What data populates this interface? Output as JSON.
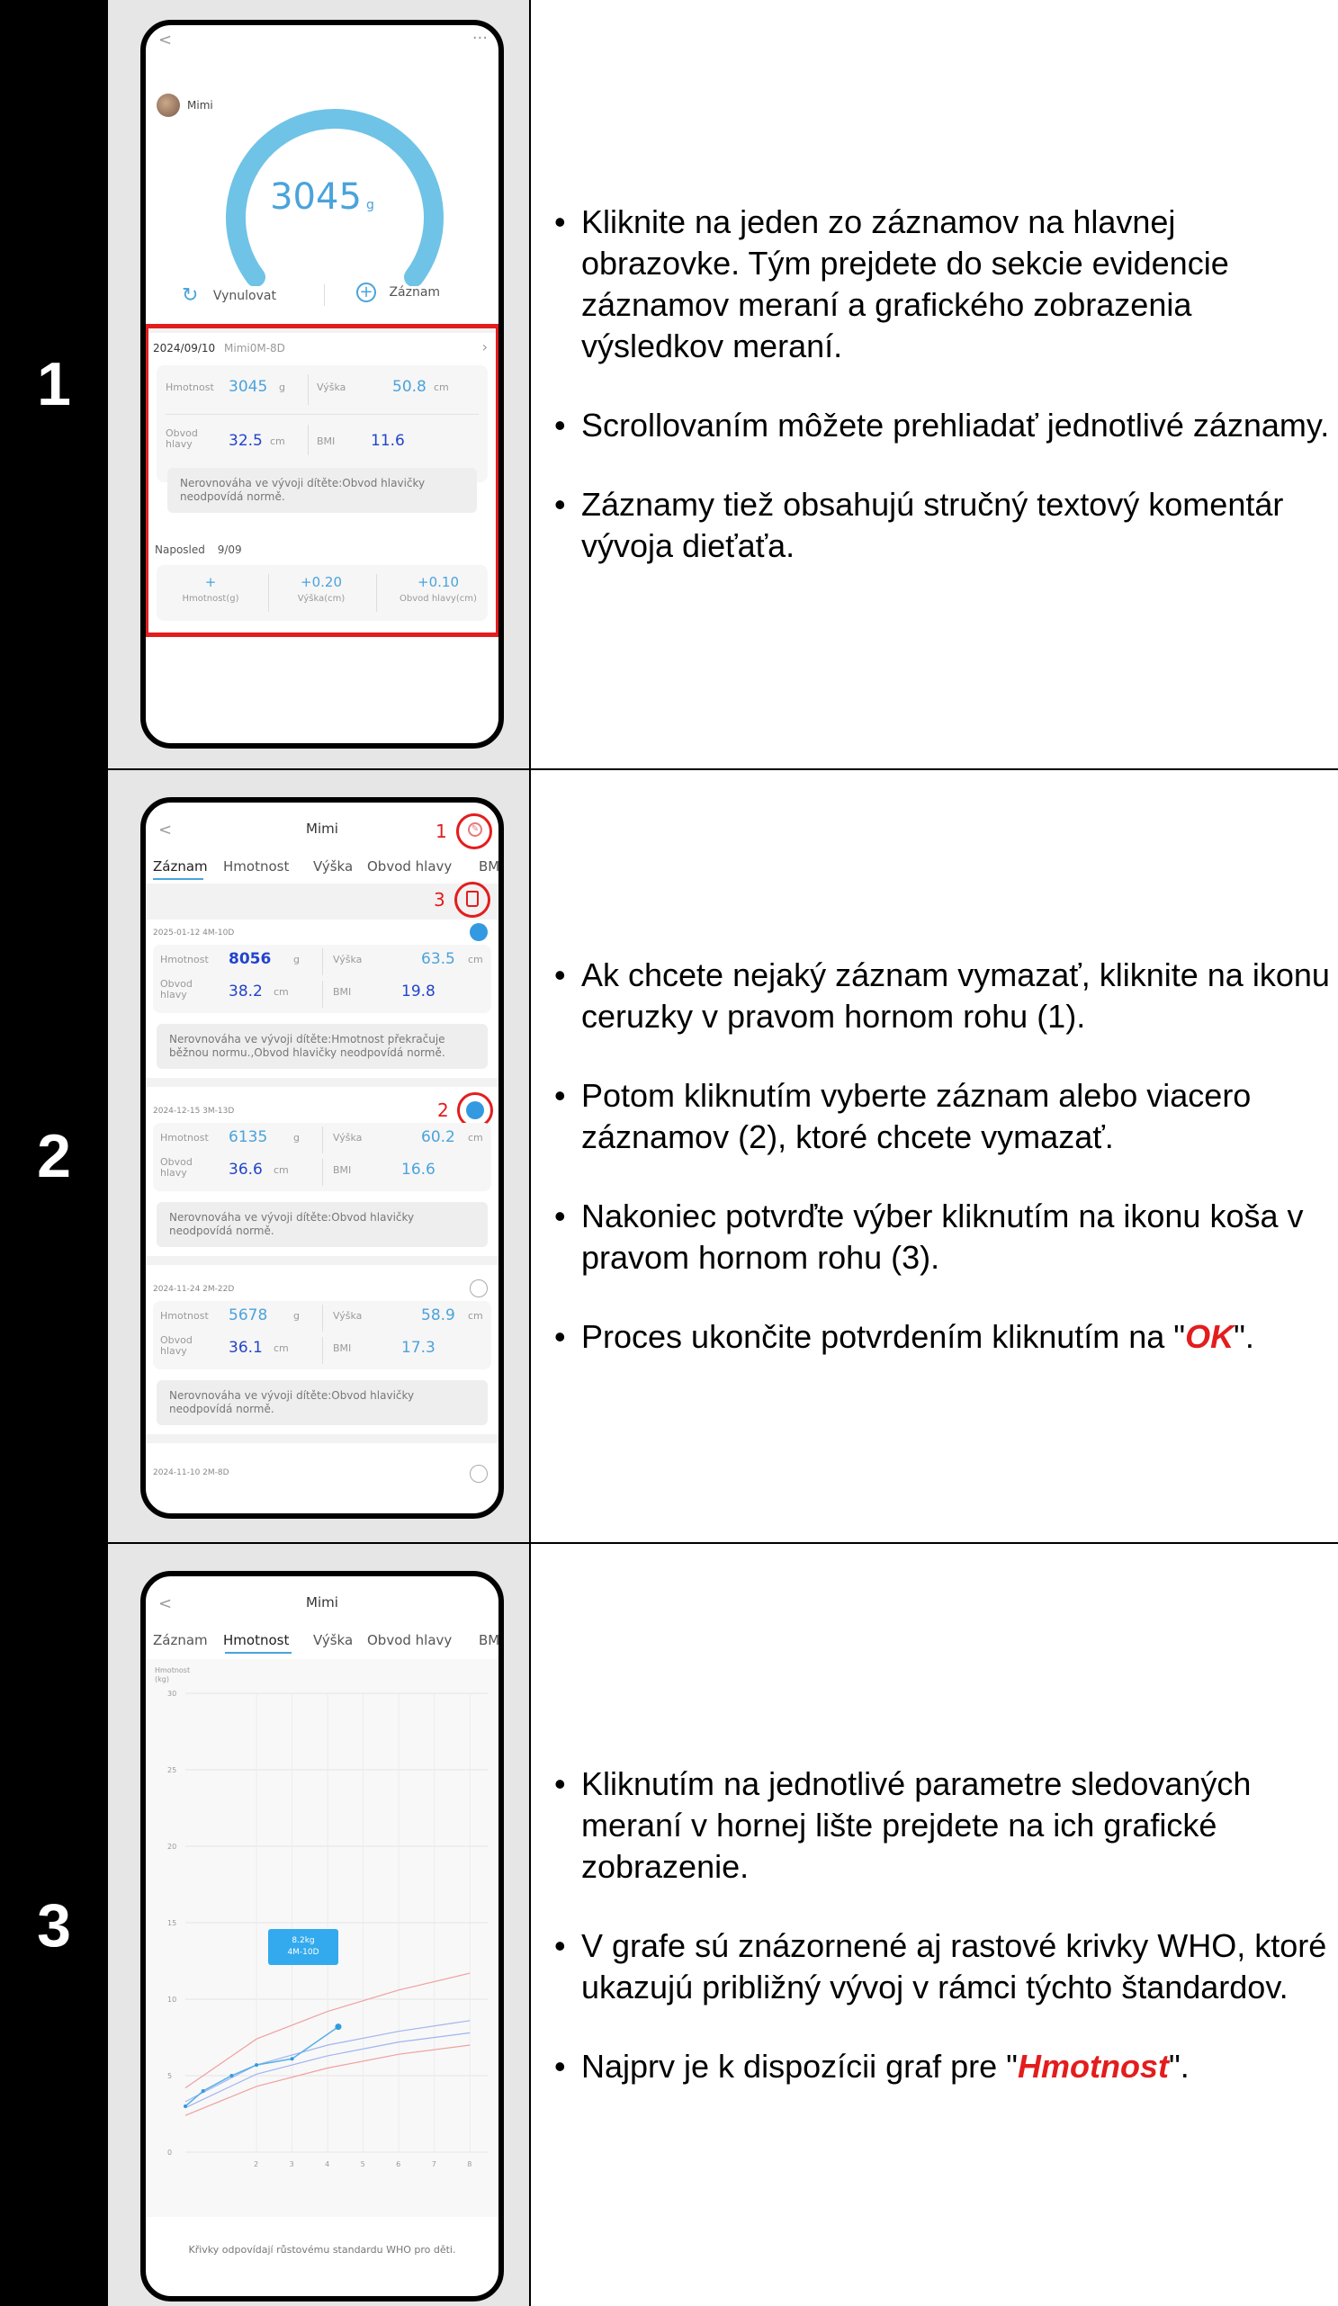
{
  "rows": [
    {
      "number": "1",
      "bullets": [
        "Kliknite na jeden zo záznamov na hlavnej obrazovke. Tým prejdete do sekcie evidencie záznamov meraní a grafického zobrazenia výsledkov meraní.",
        "Scrollovaním môžete prehliadať jednotlivé záznamy.",
        "Záznamy tiež obsahujú stručný textový komentár vývoja dieťaťa."
      ],
      "phone": {
        "back": "<",
        "menu": "···",
        "user": "Mimi",
        "weight": "3045",
        "weight_unit": "g",
        "reset_label": "Vynulovat",
        "add_label": "Záznam",
        "record_date": "2024/09/10",
        "record_age": "Mimi0M-8D",
        "hmotnost_label": "Hmotnost",
        "hmotnost_value": "3045",
        "hmotnost_unit": "g",
        "vyska_label": "Výška",
        "vyska_value": "50.8",
        "vyska_unit": "cm",
        "obvod_label": "Obvod hlavy",
        "obvod_value": "32.5",
        "obvod_unit": "cm",
        "bmi_label": "BMI",
        "bmi_value": "11.6",
        "note": "Nerovnováha ve vývoji dítěte:Obvod hlavičky neodpovídá normě.",
        "last_label": "Naposled",
        "last_date": "9/09",
        "delta_weight": "+",
        "delta_weight_label": "Hmotnost(g)",
        "delta_height": "+0.20",
        "delta_height_label": "Výška(cm)",
        "delta_head": "+0.10",
        "delta_head_label": "Obvod hlavy(cm)"
      }
    },
    {
      "number": "2",
      "bullets": [
        "Ak chcete nejaký záznam vymazať, kliknite na ikonu ceruzky v pravom hornom rohu (1).",
        "Potom kliknutím vyberte záznam alebo viacero záznamov (2), ktoré chcete vymazať.",
        "Nakoniec potvrďte výber kliknutím na ikonu koša v pravom hornom rohu (3)."
      ],
      "bullet4_prefix": "Proces ukončite potvrdením kliknutím na \"",
      "bullet4_em": "OK",
      "bullet4_suffix": "\".",
      "phone": {
        "back": "<",
        "title": "Mimi",
        "tabs": [
          "Záznam",
          "Hmotnost",
          "Výška",
          "Obvod hlavy",
          "BMI"
        ],
        "callout_1": "1",
        "callout_2": "2",
        "callout_3": "3",
        "records": [
          {
            "date": "2025-01-12 4M-10D",
            "weight": "8056",
            "height": "63.5",
            "head": "38.2",
            "bmi": "19.8",
            "note": "Nerovnováha ve vývoji dítěte:Hmotnost překračuje běžnou normu.,Obvod hlavičky neodpovídá normě."
          },
          {
            "date": "2024-12-15 3M-13D",
            "weight": "6135",
            "height": "60.2",
            "head": "36.6",
            "bmi": "16.6",
            "note": "Nerovnováha ve vývoji dítěte:Obvod hlavičky neodpovídá normě."
          },
          {
            "date": "2024-11-24 2M-22D",
            "weight": "5678",
            "height": "58.9",
            "head": "36.1",
            "bmi": "17.3",
            "note": "Nerovnováha ve vývoji dítěte:Obvod hlavičky neodpovídá normě."
          },
          {
            "date": "2024-11-10 2M-8D"
          }
        ],
        "lbl_hmotnost": "Hmotnost",
        "lbl_vyska": "Výška",
        "lbl_obvod": "Obvod hlavy",
        "lbl_bmi": "BMI",
        "unit_g": "g",
        "unit_cm": "cm"
      }
    },
    {
      "number": "3",
      "bullets": [
        "Kliknutím na jednotlivé parametre sledovaných meraní v hornej lište prejdete na ich grafické zobrazenie.",
        "V grafe sú znázornené aj rastové krivky WHO, ktoré ukazujú približný vývoj v rámci týchto štandardov."
      ],
      "bullet3_prefix": "Najprv je k dispozícii graf pre \"",
      "bullet3_em": "Hmotnost",
      "bullet3_suffix": "\".",
      "phone": {
        "back": "<",
        "title": "Mimi",
        "tabs": [
          "Záznam",
          "Hmotnost",
          "Výška",
          "Obvod hlavy",
          "BMI"
        ],
        "y_label": "Hmotnost (kg)",
        "tooltip_value": "8.2kg",
        "tooltip_age": "4M-10D",
        "footer": "Křivky odpovídají růstovému standardu WHO pro děti."
      }
    }
  ],
  "chart_data": {
    "type": "line",
    "ylabel": "Hmotnost (kg)",
    "xlabel": "",
    "ylim": [
      0,
      30
    ],
    "y_ticks": [
      0,
      5,
      10,
      15,
      20,
      25,
      30
    ],
    "x_ticks": [
      2,
      3,
      4,
      5,
      6,
      7,
      8
    ],
    "series": [
      {
        "x": [
          0,
          0.5,
          1.3,
          2,
          3,
          4.3
        ],
        "values": [
          3.0,
          4.0,
          5.0,
          5.7,
          6.1,
          8.2
        ]
      }
    ],
    "reference_curves": [
      {
        "color": "#f0a0a0",
        "x": [
          0,
          2,
          4,
          6,
          8
        ],
        "values": [
          4.2,
          7.4,
          9.2,
          10.6,
          11.7
        ]
      },
      {
        "color": "#f0a0a0",
        "x": [
          0,
          2,
          4,
          6,
          8
        ],
        "values": [
          2.4,
          4.3,
          5.5,
          6.4,
          7.0
        ]
      },
      {
        "color": "#a0b4f0",
        "x": [
          0,
          2,
          4,
          6,
          8
        ],
        "values": [
          3.3,
          5.7,
          7.0,
          7.9,
          8.6
        ]
      },
      {
        "color": "#a0b4f0",
        "x": [
          0,
          2,
          4,
          6,
          8
        ],
        "values": [
          2.9,
          5.1,
          6.3,
          7.2,
          7.8
        ]
      }
    ]
  }
}
